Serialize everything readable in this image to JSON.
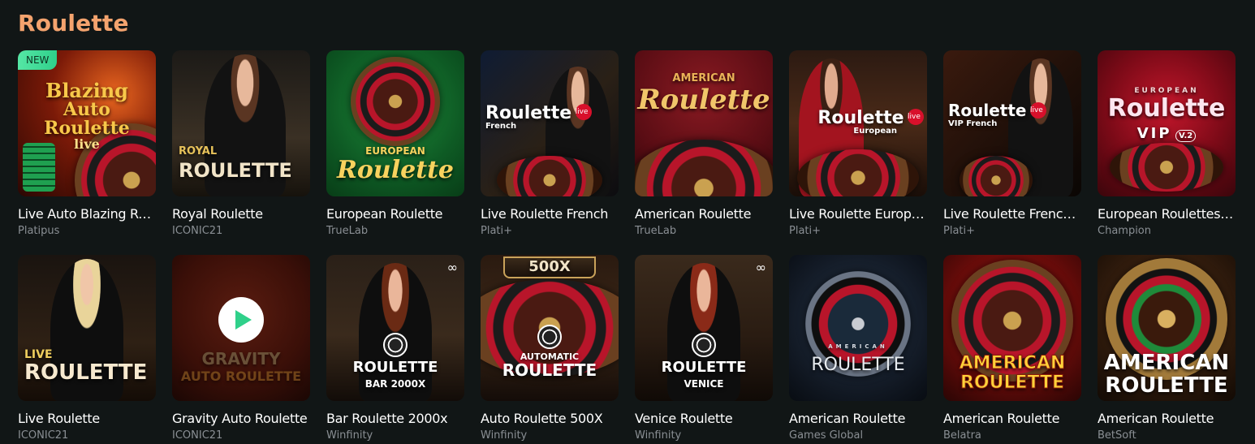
{
  "section": {
    "title": "Roulette"
  },
  "badges": {
    "new": "NEW"
  },
  "rows": [
    [
      {
        "name": "Live Auto Blazing Rou...",
        "provider": "Platipus",
        "art": [
          "Blazing",
          "Auto Roulette",
          "live"
        ]
      },
      {
        "name": "Royal Roulette",
        "provider": "ICONIC21",
        "art": [
          "ROYAL",
          "ROULETTE"
        ]
      },
      {
        "name": "European Roulette",
        "provider": "TrueLab",
        "art": [
          "EUROPEAN",
          "Roulette"
        ]
      },
      {
        "name": "Live Roulette French",
        "provider": "Plati+",
        "art": [
          "Roulette",
          "French",
          "live"
        ]
      },
      {
        "name": "American Roulette",
        "provider": "TrueLab",
        "art": [
          "AMERICAN",
          "Roulette"
        ]
      },
      {
        "name": "Live Roulette European",
        "provider": "Plati+",
        "art": [
          "Roulette",
          "European",
          "live"
        ]
      },
      {
        "name": "Live Roulette French ...",
        "provider": "Plati+",
        "art": [
          "Roulette",
          "VIP French",
          "live"
        ]
      },
      {
        "name": "European Roulettes V...",
        "provider": "Champion",
        "art": [
          "EUROPEAN",
          "Roulette",
          "VIP",
          "V.2"
        ]
      }
    ],
    [
      {
        "name": "Live Roulette",
        "provider": "ICONIC21",
        "art": [
          "LIVE",
          "ROULETTE"
        ]
      },
      {
        "name": "Gravity Auto Roulette",
        "provider": "ICONIC21",
        "art": [
          "GRAVITY",
          "AUTO ROULETTE"
        ]
      },
      {
        "name": "Bar Roulette 2000x",
        "provider": "Winfinity",
        "art": [
          "ROULETTE",
          "BAR 2000X"
        ]
      },
      {
        "name": "Auto Roulette 500X",
        "provider": "Winfinity",
        "art": [
          "500X",
          "AUTOMATIC",
          "ROULETTE"
        ]
      },
      {
        "name": "Venice Roulette",
        "provider": "Winfinity",
        "art": [
          "ROULETTE",
          "VENICE"
        ]
      },
      {
        "name": "American Roulette",
        "provider": "Games Global",
        "art": [
          "AMERICAN",
          "ROULETTE"
        ]
      },
      {
        "name": "American Roulette",
        "provider": "Belatra",
        "art": [
          "AMERICAN",
          "ROULETTE"
        ]
      },
      {
        "name": "American Roulette",
        "provider": "BetSoft",
        "art": [
          "AMERICAN",
          "ROULETTE"
        ]
      }
    ]
  ],
  "colors": {
    "accent": "#f4a36e",
    "background": "#111616",
    "new_badge": "#2fd08a",
    "provider_text": "#8a8f94"
  }
}
